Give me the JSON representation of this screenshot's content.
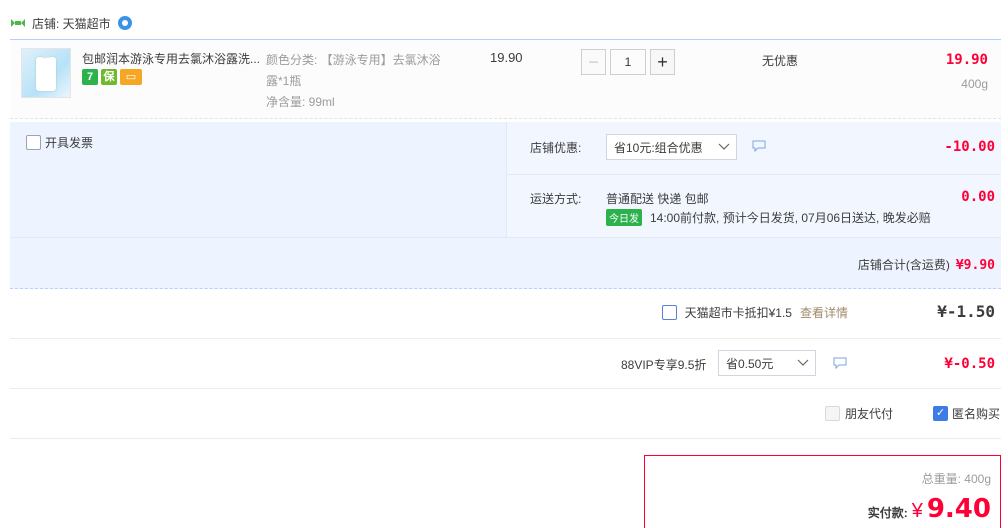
{
  "shop": {
    "label": "店铺: 天猫超市"
  },
  "item": {
    "title": "包邮润本游泳专用去氯沐浴露洗...",
    "sku_line1": "颜色分类: 【游泳专用】去氯沐浴",
    "sku_line2": "露*1瓶",
    "sku_line3": "净含量: 99ml",
    "unit_price": "19.90",
    "quantity": "1",
    "minus": "−",
    "plus": "+",
    "promo": "无优惠",
    "total": "19.90",
    "weight": "400g"
  },
  "order": {
    "invoice_label": "开具发票",
    "shop_discount_label": "店铺优惠:",
    "shop_discount_value": "省10元:组合优惠",
    "shop_discount_amount": "-10.00",
    "shipping_label": "运送方式:",
    "shipping_method": "普通配送 快递 包邮",
    "today_tag": "今日发",
    "shipping_note": "14:00前付款, 预计今日发货, 07月06日送达, 晚发必赔",
    "shipping_amount": "0.00",
    "shop_total_label": "店铺合计(含运费)",
    "shop_total_amount": "¥9.90"
  },
  "card": {
    "label": "天猫超市卡抵扣¥1.5",
    "link": "查看详情",
    "amount": "¥-1.50"
  },
  "vip": {
    "label": "88VIP专享9.5折",
    "select_value": "省0.50元",
    "amount": "¥-0.50"
  },
  "options": {
    "friend_pay": "朋友代付",
    "anonymous": "匿名购买"
  },
  "summary": {
    "weight": "总重量: 400g",
    "pay_label": "实付款:",
    "currency": "¥",
    "pay_amount": "9.40"
  },
  "colors": {
    "accent": "#ff0036",
    "border": "#b2d1ff",
    "panel": "#eef4ff"
  }
}
